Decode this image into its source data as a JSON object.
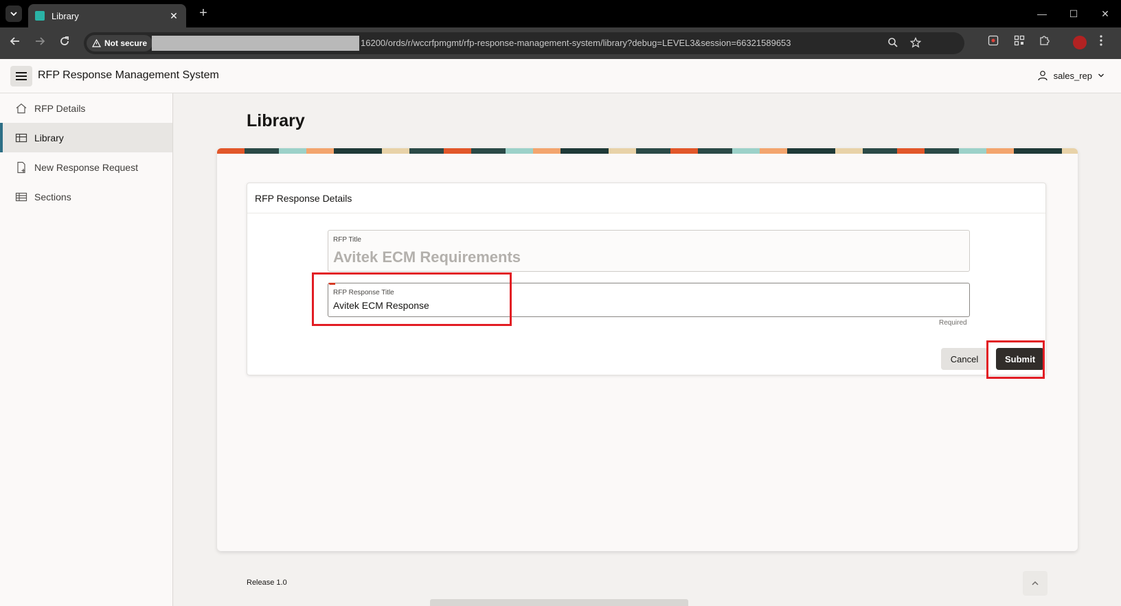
{
  "browser": {
    "tab_title": "Library",
    "tab_close": "✕",
    "new_tab": "+",
    "security_label": "Not secure",
    "url": "16200/ords/r/wccrfpmgmt/rfp-response-management-system/library?debug=LEVEL3&session=66321589653",
    "window_controls": [
      "—",
      "☐",
      "✕"
    ]
  },
  "app": {
    "title": "RFP Response Management System",
    "user": "sales_rep"
  },
  "sidebar": {
    "items": [
      {
        "label": "RFP Details",
        "icon": "home-icon",
        "active": false
      },
      {
        "label": "Library",
        "icon": "grid-icon",
        "active": true
      },
      {
        "label": "New Response Request",
        "icon": "new-document-icon",
        "active": false
      },
      {
        "label": "Sections",
        "icon": "table-icon",
        "active": false
      }
    ]
  },
  "page": {
    "title": "Library",
    "region_title": "RFP Response Details",
    "fields": {
      "rfp_title_label": "RFP Title",
      "rfp_title_value": "Avitek ECM Requirements",
      "response_title_label": "RFP Response Title",
      "response_title_value": "Avitek ECM Response",
      "required_text": "Required"
    },
    "buttons": {
      "cancel": "Cancel",
      "submit": "Submit"
    },
    "footer": "Release 1.0"
  },
  "colors": {
    "accent": "#2e6f86",
    "submit_bg": "#312d2a",
    "highlight": "#e21d24"
  }
}
